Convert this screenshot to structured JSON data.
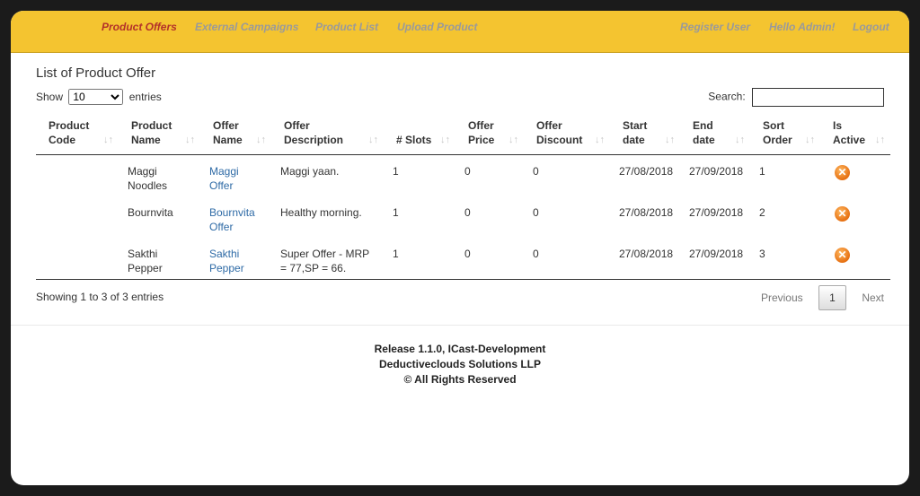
{
  "nav": {
    "left": [
      {
        "label": "Product Offers",
        "active": true
      },
      {
        "label": "External Campaigns",
        "active": false
      },
      {
        "label": "Product List",
        "active": false
      },
      {
        "label": "Upload Product",
        "active": false
      }
    ],
    "right": [
      {
        "label": "Register User"
      },
      {
        "label": "Hello Admin!"
      },
      {
        "label": "Logout"
      }
    ]
  },
  "page": {
    "title": "List of Product Offer",
    "show_prefix": "Show",
    "show_value": "10",
    "show_suffix": "entries",
    "search_label": "Search:",
    "search_value": ""
  },
  "table": {
    "headers": [
      [
        "Product",
        "Code"
      ],
      [
        "Product",
        "Name"
      ],
      [
        "Offer",
        "Name"
      ],
      [
        "Offer",
        "Description"
      ],
      [
        "# Slots",
        ""
      ],
      [
        "Offer",
        "Price"
      ],
      [
        "Offer",
        "Discount"
      ],
      [
        "Start",
        "date"
      ],
      [
        "End",
        "date"
      ],
      [
        "Sort",
        "Order"
      ],
      [
        "Is",
        "Active"
      ]
    ],
    "rows": [
      {
        "code": "",
        "name": "Maggi Noodles",
        "offer": "Maggi Offer",
        "desc": "Maggi yaan.",
        "slots": "1",
        "price": "0",
        "discount": "0",
        "start": "27/08/2018",
        "end": "27/09/2018",
        "order": "1",
        "active_icon": "x-circle-icon"
      },
      {
        "code": "",
        "name": "Bournvita",
        "offer": "Bournvita Offer",
        "desc": "Healthy morning.",
        "slots": "1",
        "price": "0",
        "discount": "0",
        "start": "27/08/2018",
        "end": "27/09/2018",
        "order": "2",
        "active_icon": "x-circle-icon"
      },
      {
        "code": "",
        "name": "Sakthi Pepper",
        "offer": "Sakthi Pepper",
        "desc": "Super Offer - MRP = 77,SP = 66.",
        "slots": "1",
        "price": "0",
        "discount": "0",
        "start": "27/08/2018",
        "end": "27/09/2018",
        "order": "3",
        "active_icon": "x-circle-icon"
      }
    ]
  },
  "summary": "Showing 1 to 3 of 3 entries",
  "pagination": {
    "previous": "Previous",
    "page": "1",
    "next": "Next"
  },
  "footer": {
    "line1": "Release 1.1.0, ICast-Development",
    "line2": "Deductiveclouds Solutions LLP",
    "line3": "© All Rights Reserved"
  },
  "colors": {
    "navbar": "#f4c430",
    "active_nav": "#b3312a",
    "link": "#2f6ba6",
    "icon": "#e67012"
  }
}
